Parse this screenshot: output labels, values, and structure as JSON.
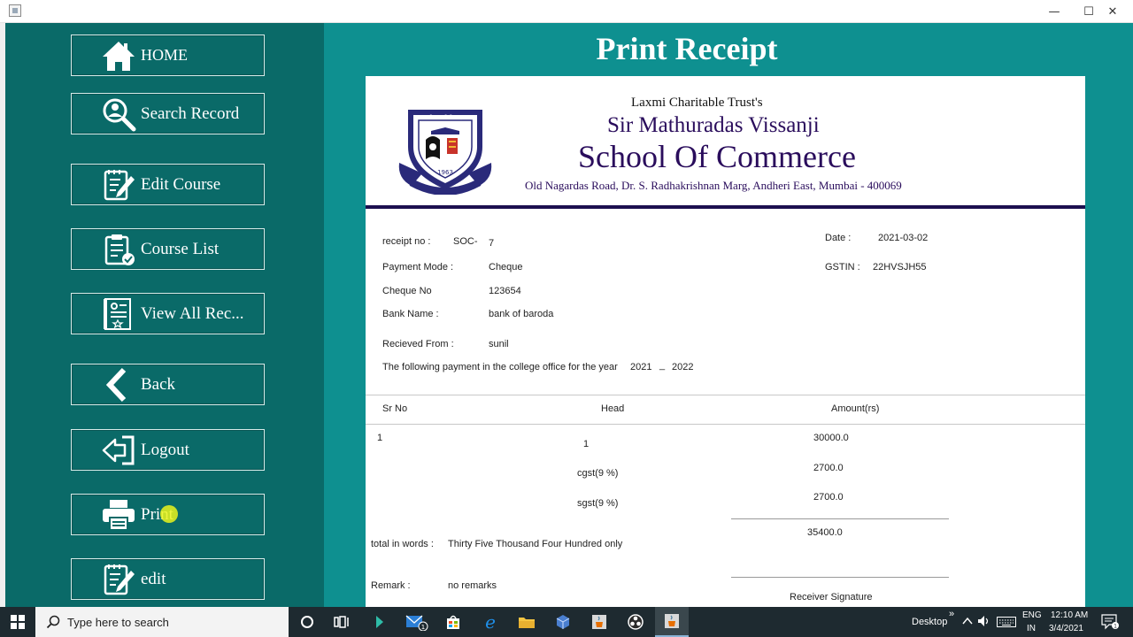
{
  "window": {
    "minimize": "—",
    "maximize": "☐",
    "close": "✕"
  },
  "nav": {
    "home": "HOME",
    "search_record": "Search Record",
    "edit_course": "Edit Course",
    "course_list": "Course List",
    "view_all": "View All Rec...",
    "back": "Back",
    "logout": "Logout",
    "print": "Print",
    "edit": "edit"
  },
  "page_title": "Print Receipt",
  "header": {
    "trust": "Laxmi Charitable Trust's",
    "school_line1": "Sir Mathuradas Vissanji",
    "school_line2": "School Of Commerce",
    "address": "Old Nagardas Road, Dr. S. Radhakrishnan Marg, Andheri East, Mumbai - 400069"
  },
  "receipt": {
    "receipt_no_label": "receipt no :",
    "receipt_prefix": "SOC-",
    "receipt_no": "7",
    "date_label": "Date :",
    "date": "2021-03-02",
    "payment_mode_label": "Payment Mode :",
    "payment_mode": "Cheque",
    "gstin_label": "GSTIN :",
    "gstin": "22HVSJH55",
    "cheque_no_label": "Cheque No",
    "cheque_no": "123654",
    "bank_name_label": "Bank Name :",
    "bank_name": "bank of baroda",
    "received_from_label": "Recieved From :",
    "received_from": "sunil",
    "year_text": "The following payment in the college office for the year",
    "year_from": "2021",
    "year_sep": "_",
    "year_to": "2022",
    "columns": {
      "sr_no": "Sr No",
      "head": "Head",
      "amount": "Amount(rs)"
    },
    "row_sr": "1",
    "row_head": "1",
    "row_amount": "30000.0",
    "cgst_label": "cgst(9 %)",
    "cgst_amount": "2700.0",
    "sgst_label": "sgst(9 %)",
    "sgst_amount": "2700.0",
    "total": "35400.0",
    "total_words_label": "total in words :",
    "total_words": "Thirty Five Thousand Four Hundred only",
    "remark_label": "Remark :",
    "remark": "no remarks",
    "signature": "Receiver Signature"
  },
  "crest_text": {
    "top": "विद्या ददाति विनयम्",
    "bottom": "1963"
  },
  "taskbar": {
    "search_placeholder": "Type here to search",
    "desktop": "Desktop",
    "chevron": "»",
    "lang_top": "ENG",
    "lang_bottom": "IN",
    "time": "12:10 AM",
    "date": "3/4/2021",
    "mail_badge": "1",
    "notif_badge": "1"
  },
  "colors": {
    "sidebar": "#0a6a68",
    "content_bg": "#0e9090",
    "school_text": "#2a0d5c",
    "taskbar": "#1e2a30"
  }
}
